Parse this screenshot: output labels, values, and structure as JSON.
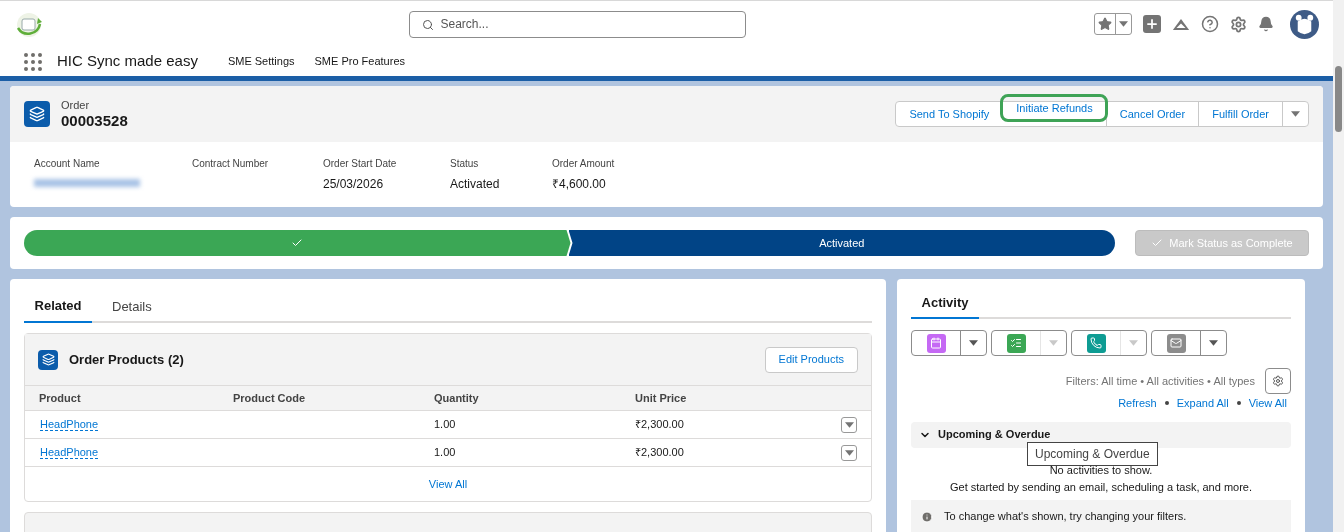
{
  "header": {
    "search": {
      "placeholder": "Search..."
    },
    "app_name": "HIC Sync made easy",
    "nav_items": [
      {
        "label": "SME Settings",
        "selected": false
      },
      {
        "label": "SME Pro Features",
        "selected": false
      }
    ]
  },
  "record": {
    "object_label": "Order",
    "title": "00003528",
    "actions": [
      {
        "label": "Send To Shopify",
        "highlighted": false
      },
      {
        "label": "Initiate Refunds",
        "highlighted": true
      },
      {
        "label": "Cancel Order",
        "highlighted": false
      },
      {
        "label": "Fulfill Order",
        "highlighted": false
      }
    ],
    "fields": [
      {
        "label": "Account Name",
        "kind": "redacted"
      },
      {
        "label": "Contract Number",
        "kind": "text"
      },
      {
        "label": "Order Start Date",
        "kind": "text",
        "value": "25/03/2026"
      },
      {
        "label": "Status",
        "kind": "text",
        "value": "Activated"
      },
      {
        "label": "Order Amount",
        "kind": "text",
        "value": "₹4,600.00"
      }
    ]
  },
  "path": {
    "stages": [
      {
        "complete": true,
        "selected": false
      },
      {
        "label": "Activated",
        "complete": false,
        "selected": true
      }
    ],
    "complete_button": {
      "label": "Mark Status as Complete",
      "disabled": true
    }
  },
  "related": {
    "tabs": [
      {
        "label": "Related",
        "selected": true
      },
      {
        "label": "Details",
        "selected": false
      }
    ],
    "card": {
      "title": "Order Products (2)",
      "button": "Edit Products",
      "columns": [
        "Product",
        "Product Code",
        "Quantity",
        "Unit Price"
      ],
      "rows": [
        {
          "product": "HeadPhone",
          "quantity": "1.00",
          "unit_price": "₹2,300.00"
        },
        {
          "product": "HeadPhone",
          "quantity": "1.00",
          "unit_price": "₹2,300.00"
        }
      ],
      "view_all": "View All"
    }
  },
  "activity": {
    "tabs": [
      {
        "label": "Activity",
        "selected": true
      }
    ],
    "composer": [
      {
        "kind": "event",
        "disabled": false
      },
      {
        "kind": "task",
        "disabled": true
      },
      {
        "kind": "call",
        "disabled": true
      },
      {
        "kind": "email",
        "disabled": false
      }
    ],
    "filters": "Filters: All time • All activities • All types",
    "links": [
      "Refresh",
      "Expand All",
      "View All"
    ],
    "section": {
      "title": "Upcoming & Overdue",
      "expanded": true,
      "tooltip": "Upcoming & Overdue",
      "empty_title": "No activities to show.",
      "empty_text": "Get started by sending an email, scheduling a task, and more."
    },
    "info": "To change what's shown, try changing your filters."
  }
}
